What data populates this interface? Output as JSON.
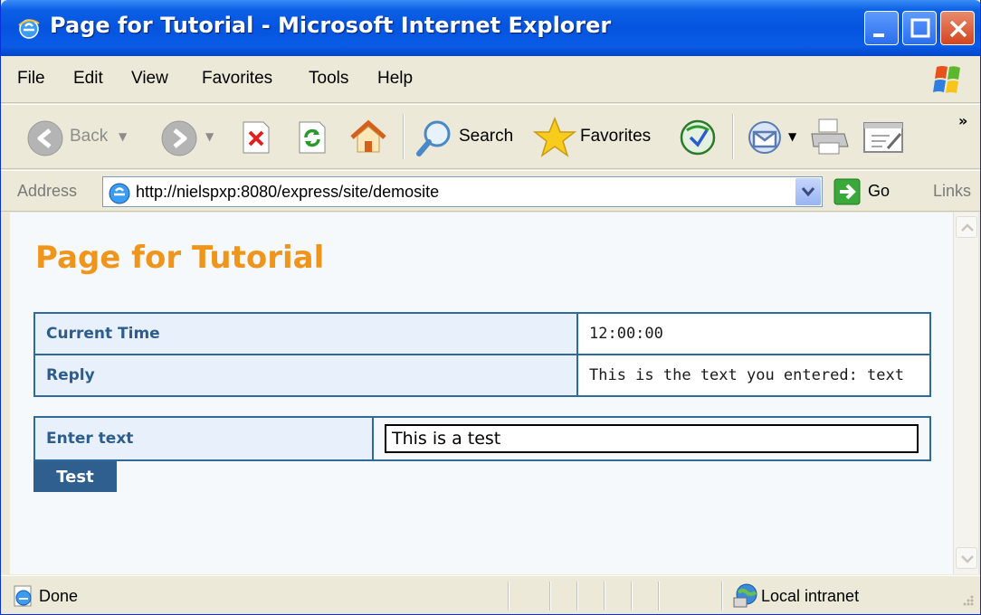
{
  "window": {
    "title": "Page for Tutorial - Microsoft Internet Explorer"
  },
  "menu": {
    "items": [
      "File",
      "Edit",
      "View",
      "Favorites",
      "Tools",
      "Help"
    ]
  },
  "toolbar": {
    "back_label": "Back",
    "search_label": "Search",
    "favorites_label": "Favorites"
  },
  "address": {
    "label": "Address",
    "url": "http://nielspxp:8080/express/site/demosite",
    "go_label": "Go",
    "links_label": "Links"
  },
  "page": {
    "heading": "Page for Tutorial",
    "info_rows": [
      {
        "key": "Current Time",
        "value": "12:00:00"
      },
      {
        "key": "Reply",
        "value": "This is the text you entered: text"
      }
    ],
    "form": {
      "label": "Enter text",
      "value": "This is a test",
      "button": "Test"
    }
  },
  "status": {
    "text": "Done",
    "zone": "Local intranet"
  },
  "colors": {
    "heading": "#f0951c",
    "table_border": "#2e6a9a",
    "button_bg": "#2f5f8f",
    "key_text": "#2d5d8c"
  }
}
